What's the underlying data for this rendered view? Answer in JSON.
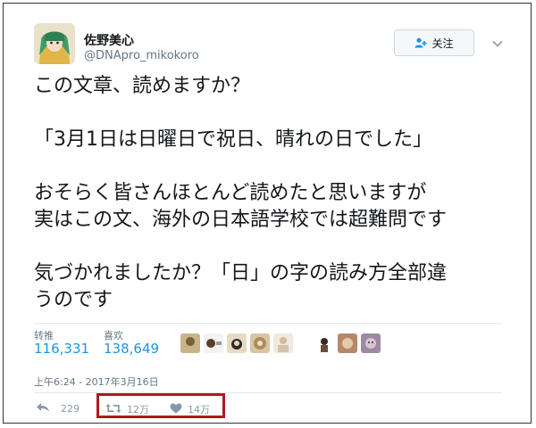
{
  "user": {
    "display_name": "佐野美心",
    "handle": "@DNApro_mikokoro"
  },
  "follow_button": {
    "label": "关注",
    "icon": "add-user-icon"
  },
  "more_menu": {
    "icon": "chevron-down-icon"
  },
  "tweet": {
    "lines": [
      "この文章、読めますか？",
      "「3月1日は日曜日で祝日、晴れの日でした」",
      "おそらく皆さんほとんど読めたと思いますが",
      "実はこの文、海外の日本語学校では超難問です",
      "気づかれましたか？「日」の字の読み方全部違",
      "うのです"
    ]
  },
  "stats": {
    "retweets_label": "转推",
    "retweets_value": "116,331",
    "likes_label": "喜欢",
    "likes_value": "138,649"
  },
  "likers": [
    "liker-avatar-1",
    "liker-avatar-2",
    "liker-avatar-3",
    "liker-avatar-4",
    "liker-avatar-5",
    "liker-avatar-6",
    "liker-avatar-7",
    "liker-avatar-8",
    "liker-avatar-9"
  ],
  "timestamp": "上午6:24 - 2017年3月16日",
  "actions": {
    "reply_count": "229",
    "retweet_count": "12万",
    "like_count": "14万"
  },
  "colors": {
    "link_blue": "#1b95e0",
    "muted": "#657786",
    "highlight_red": "#b3171d"
  }
}
